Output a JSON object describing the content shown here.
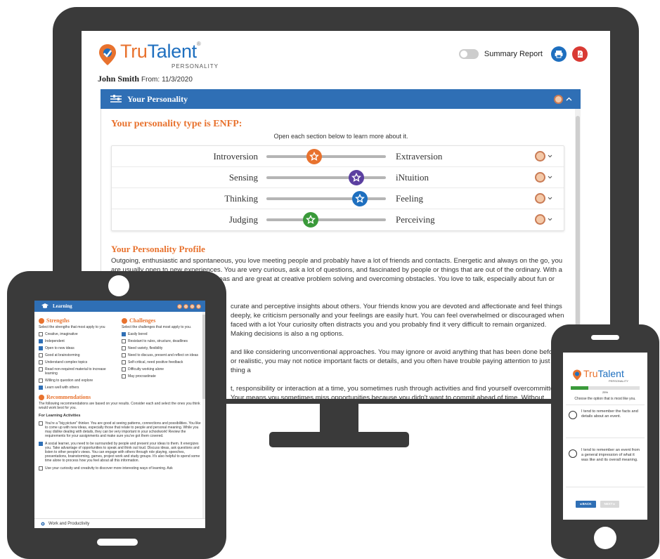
{
  "brand": {
    "name_left": "Tru",
    "name_right": "Talent",
    "trademark": "®",
    "subtitle": "PERSONALITY"
  },
  "user": {
    "name": "John Smith",
    "from_label": "From:",
    "date": "11/3/2020"
  },
  "summary": {
    "label": "Summary Report"
  },
  "personality_panel": {
    "title": "Your Personality",
    "type_heading": "Your personality type is ENFP:",
    "instruction": "Open each section below to learn more about it.",
    "scales": [
      {
        "left": "Introversion",
        "right": "Extraversion",
        "position": 0.4,
        "color": "#e8722e"
      },
      {
        "left": "Sensing",
        "right": "iNtuition",
        "position": 0.75,
        "color": "#5b3fa0"
      },
      {
        "left": "Thinking",
        "right": "Feeling",
        "position": 0.78,
        "color": "#1e6fbf"
      },
      {
        "left": "Judging",
        "right": "Perceiving",
        "position": 0.37,
        "color": "#3a9a3a"
      }
    ],
    "profile_title": "Your Personality Profile",
    "profile_paragraphs": [
      "Outgoing, enthusiastic and spontaneous, you love meeting people and probably have a lot of friends and contacts. Energetic and always on the go, you are usually open to new experiences. You are very curious, ask a lot of questions, and fascinated by people or things that are out of the ordinary. With a vivid imagination, you have lots of ideas and are great at creative problem solving and overcoming obstacles. You love to talk, especially about fun or interesting possibilities, and pride",
      "curate and perceptive insights about others. Your friends know you are devoted and affectionate and feel things deeply, ke criticism personally and your feelings are easily hurt. You can feel overwhelmed or discouraged when faced with a lot Your curiosity often distracts you and you probably find it very difficult to remain organized. Making decisions is also a ng options.",
      "and like considering unconventional approaches. You may ignore or avoid anything that has been done before or realistic, you may not notice important facts or details, and you often have trouble paying attention to just one thing a",
      "t, responsibility or interaction at a time, you sometimes rush through activities and find yourself overcommitted. Your means you sometimes miss opportunities because you didn't want to commit ahead of time. Without adequate"
    ]
  },
  "tablet": {
    "header": "Learning",
    "strengths": {
      "title": "Strengths",
      "desc": "Select the strengths that most apply to you",
      "items": [
        {
          "label": "Creative, imaginative",
          "checked": false
        },
        {
          "label": "Independent",
          "checked": true
        },
        {
          "label": "Open to new ideas",
          "checked": true
        },
        {
          "label": "Good at brainstorming",
          "checked": false
        },
        {
          "label": "Understand complex topics",
          "checked": false
        },
        {
          "label": "Read non-required material to increase learning",
          "checked": false
        },
        {
          "label": "Willing to question and explore",
          "checked": false
        },
        {
          "label": "Learn well with others",
          "checked": true
        }
      ]
    },
    "challenges": {
      "title": "Challenges",
      "desc": "Select the challenges that most apply to you.",
      "items": [
        {
          "label": "Easily bored",
          "checked": true
        },
        {
          "label": "Resistant to rules, structure, deadlines",
          "checked": false
        },
        {
          "label": "Need variety, flexibility",
          "checked": false
        },
        {
          "label": "Need to discuss, present and reflect on ideas",
          "checked": false
        },
        {
          "label": "Self-critical, need positive feedback",
          "checked": false
        },
        {
          "label": "Difficulty working alone",
          "checked": false
        },
        {
          "label": "May procrastinate",
          "checked": false
        }
      ]
    },
    "recommendations": {
      "title": "Recommendations",
      "desc": "The following recommendations are based on your results. Consider each and select the ones you think would work best for you.",
      "subtitle": "For Learning Activities",
      "items": [
        {
          "label": "You're a \"big picture\" thinker. You are good at seeing patterns, connections and possibilities. You like to come up with new ideas, especially those that relate to people and personal meaning. While you may dislike dealing with details, they can be very important in your schoolwork! Review the requirements for your assignments and make sure you've got them covered.",
          "checked": false
        },
        {
          "label": "A social learner, you need to be surrounded by people and present your ideas to them. It energizes you. Take advantage of opportunities to speak and think out loud. Discuss ideas, ask questions and listen to other people's views. You can engage with others through role playing, speeches, presentations, brainstorming, games, project work and study groups. It's also helpful to spend some time alone to process how you feel about all this information.",
          "checked": true
        },
        {
          "label": "Use your curiosity and creativity to discover more interesting ways of learning. Ask",
          "checked": false
        }
      ]
    },
    "footer": "Work and Productivity"
  },
  "phone": {
    "progress_percent": 25,
    "progress_label": "25%",
    "question": "Choose the option that is most like you.",
    "options": [
      "I tend to remember the facts and details about an event.",
      "I tend to remember an event from a general impression of what it was like and its overall meaning."
    ],
    "back_label": "◂ BACK",
    "next_label": "NEXT ▸"
  },
  "colors": {
    "orange": "#e8722e",
    "blue": "#1e6fbf",
    "header_blue": "#2f6fb5",
    "device": "#3a3a3a"
  }
}
